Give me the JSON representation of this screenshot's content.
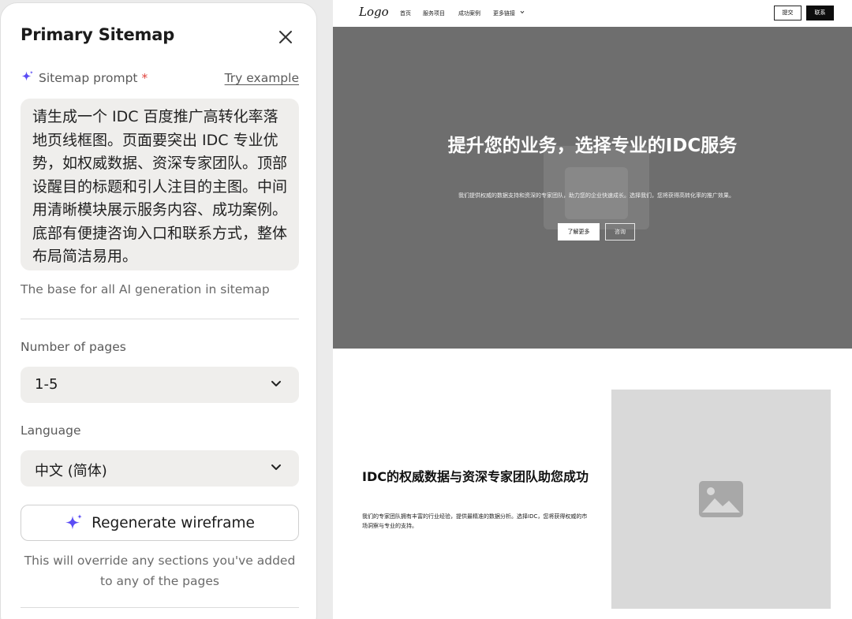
{
  "panel": {
    "title": "Primary Sitemap",
    "prompt_label": "Sitemap prompt",
    "required_mark": "*",
    "try_example": "Try example",
    "prompt_text": "请生成一个 IDC 百度推广高转化率落地页线框图。页面要突出 IDC 专业优势，如权威数据、资深专家团队。顶部设醒目的标题和引人注目的主图。中间用清晰模块展示服务内容、成功案例。底部有便捷咨询入口和联系方式，整体布局简洁易用。",
    "prompt_hint": "The base for all AI generation in sitemap",
    "pages_label": "Number of pages",
    "pages_value": "1-5",
    "language_label": "Language",
    "language_value": "中文 (简体)",
    "regenerate_label": "Regenerate wireframe",
    "regenerate_note": "This will override any sections you've added to any of the pages"
  },
  "preview": {
    "nav": {
      "logo": "Logo",
      "links": [
        "首页",
        "服务项目",
        "成功案例",
        "更多链接"
      ],
      "submit": "提交",
      "contact": "联系"
    },
    "hero": {
      "title": "提升您的业务，选择专业的IDC服务",
      "subtitle": "我们提供权威的数据支持和资深的专家团队，助力您的企业快速成长。选择我们，您将获得高转化率的推广效果。",
      "primary_button": "了解更多",
      "secondary_button": "咨询"
    },
    "section2": {
      "title": "IDC的权威数据与资深专家团队助您成功",
      "body": "我们的专家团队拥有丰富的行业经验，提供最精准的数据分析。选择IDC，您将获得权威的市场洞察与专业的支持。"
    }
  },
  "colors": {
    "accent_sparkle": "#5b4df5",
    "required": "#e0443e",
    "hero_bg": "#6e6e6e",
    "placeholder_bg": "#d9d9d9"
  },
  "icons": [
    "sparkle-icon",
    "close-icon",
    "chevron-down-icon",
    "image-placeholder-icon"
  ]
}
